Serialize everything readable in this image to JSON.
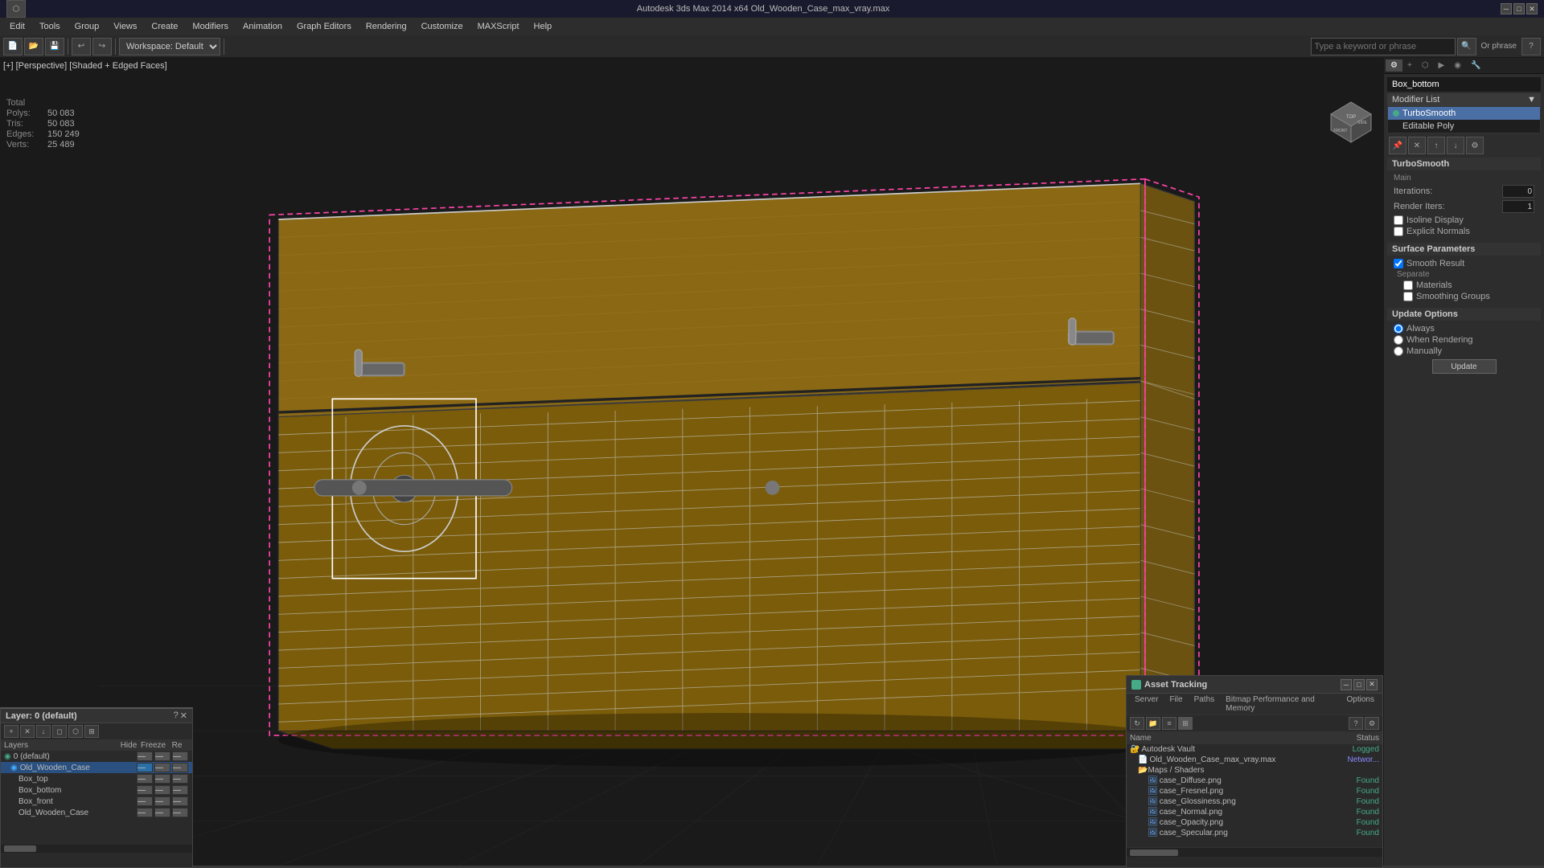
{
  "titlebar": {
    "title": "Autodesk 3ds Max 2014 x64    Old_Wooden_Case_max_vray.max",
    "minimize": "─",
    "maximize": "□",
    "close": "✕"
  },
  "menubar": {
    "items": [
      "Edit",
      "Tools",
      "Group",
      "Views",
      "Create",
      "Modifiers",
      "Animation",
      "Graph Editors",
      "Rendering",
      "Customize",
      "MAXScript",
      "Help"
    ]
  },
  "toolbar": {
    "workspace": "Workspace: Default",
    "search_placeholder": "Type a keyword or phrase",
    "or_phrase": "Or phrase"
  },
  "viewport": {
    "label": "[+] [Perspective] [Shaded + Edged Faces]",
    "stats": {
      "polys_label": "Polys:",
      "polys_total_label": "Total",
      "polys_value": "50 083",
      "tris_label": "Tris:",
      "tris_value": "50 083",
      "edges_label": "Edges:",
      "edges_value": "150 249",
      "verts_label": "Verts:",
      "verts_value": "25 489"
    }
  },
  "right_panel": {
    "object_name": "Box_bottom",
    "modifier_list_label": "Modifier List",
    "modifiers": [
      {
        "name": "TurboSmooth",
        "active": true
      },
      {
        "name": "Editable Poly",
        "active": false
      }
    ],
    "turbosmooth": {
      "label": "TurboSmooth",
      "main_label": "Main",
      "iterations_label": "Iterations:",
      "iterations_value": "0",
      "render_iters_label": "Render Iters:",
      "render_iters_value": "1",
      "isoline_label": "Isoline Display",
      "explicit_label": "Explicit Normals",
      "surface_params_label": "Surface Parameters",
      "smooth_result_label": "Smooth Result",
      "smooth_result_checked": true,
      "separate_label": "Separate",
      "materials_label": "Materials",
      "smoothing_groups_label": "Smoothing Groups",
      "update_options_label": "Update Options",
      "always_label": "Always",
      "when_rendering_label": "When Rendering",
      "manually_label": "Manually",
      "update_btn": "Update"
    }
  },
  "layers": {
    "title": "Layer: 0 (default)",
    "cols": [
      "Layers",
      "Hide",
      "Freeze",
      "Re"
    ],
    "items": [
      {
        "name": "0 (default)",
        "indent": 0,
        "selected": false
      },
      {
        "name": "Old_Wooden_Case",
        "indent": 1,
        "selected": true
      },
      {
        "name": "Box_top",
        "indent": 2,
        "selected": false
      },
      {
        "name": "Box_bottom",
        "indent": 2,
        "selected": false
      },
      {
        "name": "Box_front",
        "indent": 2,
        "selected": false
      },
      {
        "name": "Old_Wooden_Case",
        "indent": 2,
        "selected": false
      }
    ]
  },
  "asset_tracking": {
    "title": "Asset Tracking",
    "menu": [
      "Server",
      "File",
      "Paths",
      "Bitmap Performance and Memory",
      "Options"
    ],
    "cols": [
      "Name",
      "Status"
    ],
    "items": [
      {
        "name": "Autodesk Vault",
        "indent": 0,
        "status": "Logged",
        "type": "vault"
      },
      {
        "name": "Old_Wooden_Case_max_vray.max",
        "indent": 1,
        "status": "Networ...",
        "type": "file"
      },
      {
        "name": "Maps / Shaders",
        "indent": 1,
        "status": "",
        "type": "folder"
      },
      {
        "name": "case_Diffuse.png",
        "indent": 2,
        "status": "Found",
        "type": "texture"
      },
      {
        "name": "case_Fresnel.png",
        "indent": 2,
        "status": "Found",
        "type": "texture"
      },
      {
        "name": "case_Glossiness.png",
        "indent": 2,
        "status": "Found",
        "type": "texture"
      },
      {
        "name": "case_Normal.png",
        "indent": 2,
        "status": "Found",
        "type": "texture"
      },
      {
        "name": "case_Opacity.png",
        "indent": 2,
        "status": "Found",
        "type": "texture"
      },
      {
        "name": "case_Specular.png",
        "indent": 2,
        "status": "Found",
        "type": "texture"
      }
    ]
  }
}
